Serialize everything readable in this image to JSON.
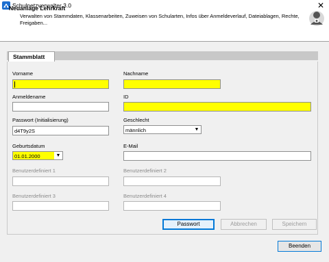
{
  "window": {
    "title": "Schulnetzverwalter 3.0",
    "close_glyph": "✕",
    "app_icon": "app-logo-icon"
  },
  "header": {
    "title": "Neuanlage Lehrkraft",
    "description": "Verwalten von Stammdaten, Klassenarbeiten, Zuweisen von Schularten, Infos über Anmeldeverlauf, Dateiablagen, Rechte, Freigaben...",
    "avatar_icon": "teacher-avatar-icon"
  },
  "tabs": [
    {
      "label": "Stammblatt",
      "active": true
    }
  ],
  "form": {
    "vorname": {
      "label": "Vorname",
      "value": "",
      "required": true
    },
    "nachname": {
      "label": "Nachname",
      "value": "",
      "required": true
    },
    "anmeldename": {
      "label": "Anmeldename",
      "value": ""
    },
    "id": {
      "label": "ID",
      "value": "",
      "required": true
    },
    "passwort": {
      "label": "Passwort (Initialisierung)",
      "value": "d4T9y2S"
    },
    "geschlecht": {
      "label": "Geschlecht",
      "value": "männlich",
      "arrow": "▼"
    },
    "geburtsdatum": {
      "label": "Geburtsdatum",
      "value": "01.01.2000",
      "arrow": "▼",
      "required": true
    },
    "email": {
      "label": "E-Mail",
      "value": ""
    },
    "benutzerdefiniert_1": {
      "label": "Benutzerdefiniert 1",
      "value": "",
      "disabled": true
    },
    "benutzerdefiniert_2": {
      "label": "Benutzerdefiniert 2",
      "value": "",
      "disabled": true
    },
    "benutzerdefiniert_3": {
      "label": "Benutzerdefiniert 3",
      "value": "",
      "disabled": true
    },
    "benutzerdefiniert_4": {
      "label": "Benutzerdefiniert 4",
      "value": "",
      "disabled": true
    }
  },
  "buttons": {
    "passwort": "Passwort",
    "abbrechen": "Abbrechen",
    "speichern": "Speichern",
    "beenden": "Beenden"
  },
  "colors": {
    "required_field": "#ffff00",
    "focus_border": "#0078d7"
  }
}
